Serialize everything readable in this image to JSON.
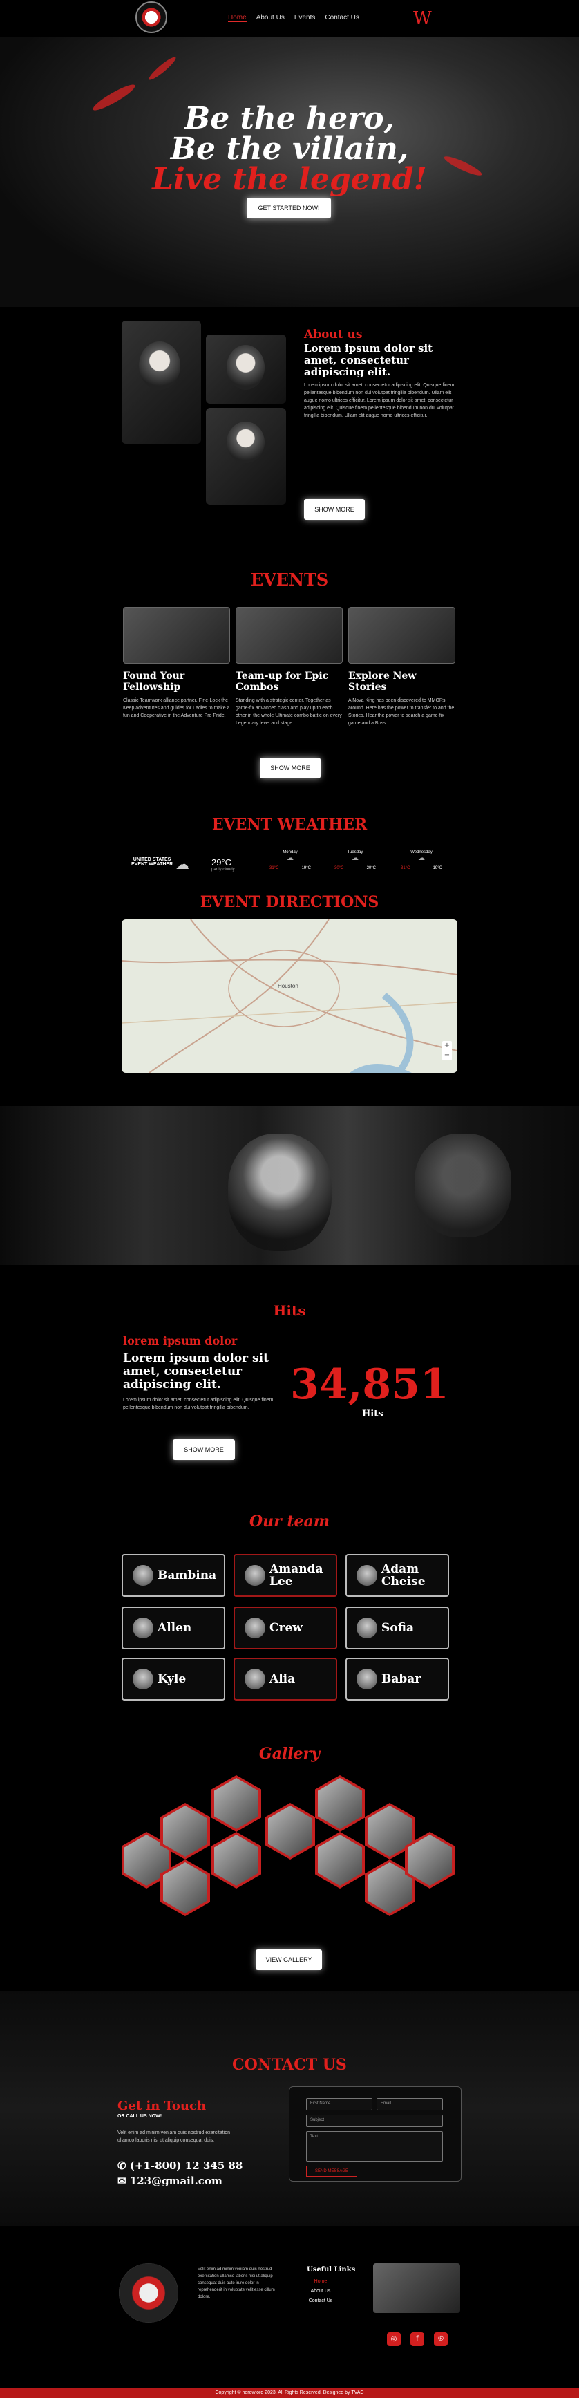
{
  "nav": {
    "links": [
      "Home",
      "About Us",
      "Events",
      "Contact Us"
    ],
    "brand_mark": "W"
  },
  "hero": {
    "line1": "Be the hero,",
    "line2": "Be the villain,",
    "line3": "Live the legend!",
    "cta": "GET STARTED NOW!"
  },
  "about": {
    "kicker": "About us",
    "title": "Lorem ipsum dolor sit amet, consectetur adipiscing elit.",
    "body": "Lorem ipsum dolor sit amet, consectetur adipiscing elit. Quisque finem pellentesque bibendum non dui volutpat fringilla bibendum. Ullam elit augue nomo ultrices efficitur. Lorem ipsum dolor sit amet, consectetur adipiscing elit. Quisque finem pellentesque bibendum non dui volutpat fringilla bibendum. Ullam elit augue nomo ultrices efficitur.",
    "button": "SHOW MORE"
  },
  "events": {
    "heading": "EVENTS",
    "cards": [
      {
        "title": "Found Your Fellowship",
        "text": "Classic Teamwork alliance partner. Fine-Lock the Keep adventures and guides for Ladies to make a fun and Cooperative in the Adventure Pro Pride."
      },
      {
        "title": "Team-up for Epic Combos",
        "text": "Standing with a strategic center. Together as game-fix advanced clash and play up to each other in the whole Ultimate combo battle on every Legendary level and stage."
      },
      {
        "title": "Explore New Stories",
        "text": "A Nova King has been discovered to MMORs around. Here has the power to transfer to and the Stories. Hear the power to search a game-fix game and a Boss."
      }
    ],
    "button": "SHOW MORE"
  },
  "weather": {
    "heading": "EVENT WEATHER",
    "location": "UNITED STATES",
    "sub": "EVENT WEATHER",
    "temp": "29°C",
    "condition": "partly cloudy",
    "days": [
      {
        "name": "Monday",
        "hi": "31°C",
        "lo": "19°C"
      },
      {
        "name": "Tuesday",
        "hi": "30°C",
        "lo": "20°C"
      },
      {
        "name": "Wednesday",
        "hi": "31°C",
        "lo": "19°C"
      }
    ]
  },
  "directions": {
    "heading": "EVENT DIRECTIONS",
    "city": "Houston"
  },
  "hits": {
    "heading": "Hits",
    "kicker": "lorem ipsum dolor",
    "title": "Lorem ipsum dolor sit amet, consectetur adipiscing elit.",
    "body": "Lorem ipsum dolor sit amet, consectetur adipiscing elit. Quisque finem pellentesque bibendum non dui volutpat fringilla bibendum.",
    "number": "34,851",
    "label": "Hits",
    "button": "SHOW MORE"
  },
  "team": {
    "heading": "Our team",
    "members": [
      "Bambina",
      "Amanda Lee",
      "Adam Cheise",
      "Allen",
      "Crew",
      "Sofia",
      "Kyle",
      "Alia",
      "Babar"
    ]
  },
  "gallery": {
    "heading": "Gallery",
    "button": "VIEW GALLERY"
  },
  "contact": {
    "heading": "CONTACT US",
    "get_in_touch": "Get in Touch",
    "call": "OR CALL US NOW!",
    "text": "Velit enim ad minim veniam quis nostrud exercitation ullamco laboris nisi ut aliquip consequat duis.",
    "phone": "(+1-800) 12 345 88",
    "email": "123@gmail.com",
    "form": {
      "first": "First Name",
      "email": "Email",
      "subject": "Subject",
      "text": "Text",
      "send": "SEND MESSAGE"
    }
  },
  "footer": {
    "text": "Velit enim ad minim veniam quis nostrud exercitation ullamco laboris nisi ut aliquip consequat duis aute irure dolor in reprehenderit in voluptate velit esse cillum dolore.",
    "links_heading": "Useful Links",
    "links": [
      "Home",
      "About Us",
      "Contact Us"
    ],
    "copyright": "Copyright © herowlord 2023. All Rights Reserved. Designed by TVAC"
  },
  "colors": {
    "accent": "#e0201d",
    "bg": "#000000"
  }
}
